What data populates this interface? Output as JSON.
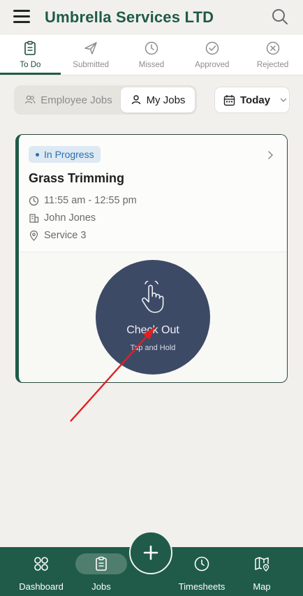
{
  "header": {
    "title": "Umbrella Services LTD",
    "menu_icon": "hamburger-menu-icon",
    "search_icon": "search-icon"
  },
  "status_tabs": [
    {
      "label": "To Do",
      "icon": "clipboard-icon",
      "active": true
    },
    {
      "label": "Submitted",
      "icon": "paper-plane-icon",
      "active": false
    },
    {
      "label": "Missed",
      "icon": "clock-icon",
      "active": false
    },
    {
      "label": "Approved",
      "icon": "check-circle-icon",
      "active": false
    },
    {
      "label": "Rejected",
      "icon": "x-circle-icon",
      "active": false
    }
  ],
  "filters": {
    "employee_jobs": "Employee Jobs",
    "my_jobs": "My Jobs",
    "selected": "My Jobs",
    "date_value": "Today"
  },
  "job": {
    "status": "In Progress",
    "title": "Grass Trimming",
    "time": "11:55 am - 12:55 pm",
    "person": "John Jones",
    "service": "Service 3"
  },
  "checkout": {
    "label": "Check Out",
    "hint": "Tap and Hold"
  },
  "bottom_nav": {
    "dashboard": "Dashboard",
    "jobs": "Jobs",
    "timesheets": "Timesheets",
    "map": "Map",
    "active": "Jobs"
  },
  "colors": {
    "brand_green": "#1f5b48",
    "checkout_bg": "#3d4a66",
    "badge_blue": "#2a6fb0",
    "annotation_arrow": "#e02020"
  }
}
